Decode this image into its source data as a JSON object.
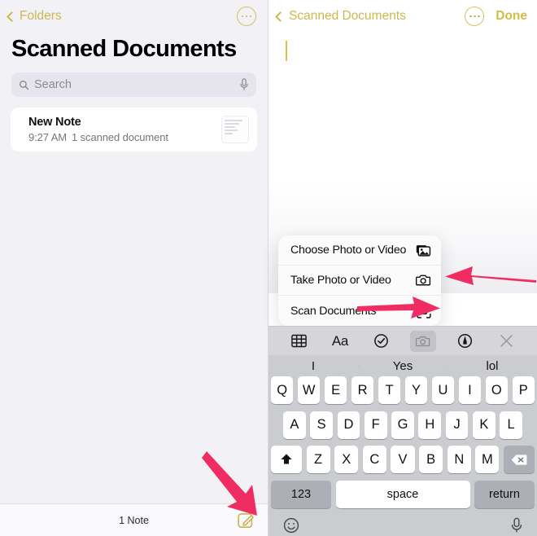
{
  "colors": {
    "accent_yellow": "#cdb84f",
    "arrow_pink": "#ef2d63",
    "panel_bg": "#f2f1f6",
    "keyboard_bg": "#cbccd0",
    "toolbar_bg": "#d6d6da"
  },
  "left_pane": {
    "back_label": "Folders",
    "more_icon": "ellipsis-circle-icon",
    "title": "Scanned Documents",
    "search": {
      "placeholder": "Search",
      "search_icon": "search-icon",
      "mic_icon": "microphone-icon"
    },
    "notes": [
      {
        "title": "New Note",
        "time": "9:27 AM",
        "detail": "1 scanned document",
        "thumb_icon": "scanned-document-thumbnail"
      }
    ],
    "bottom_bar": {
      "count_label": "1 Note",
      "compose_icon": "compose-note-icon"
    }
  },
  "right_pane": {
    "back_label": "Scanned Documents",
    "more_icon": "ellipsis-circle-icon",
    "done_label": "Done",
    "editor": {
      "text": "",
      "caret_visible": true
    },
    "action_sheet": {
      "items": [
        {
          "label": "Choose Photo or Video",
          "icon": "photo-stack-icon"
        },
        {
          "label": "Take Photo or Video",
          "icon": "camera-icon"
        },
        {
          "label": "Scan Documents",
          "icon": "scan-documents-icon"
        }
      ]
    },
    "format_toolbar": {
      "buttons": [
        {
          "name": "table-icon",
          "label": ""
        },
        {
          "name": "text-format-icon",
          "label": "Aa"
        },
        {
          "name": "checklist-icon",
          "label": ""
        },
        {
          "name": "camera-icon",
          "label": "",
          "active": true
        },
        {
          "name": "markup-pen-icon",
          "label": ""
        },
        {
          "name": "close-icon",
          "label": ""
        }
      ]
    },
    "keyboard": {
      "predictions": [
        "I",
        "Yes",
        "lol"
      ],
      "row1": [
        "Q",
        "W",
        "E",
        "R",
        "T",
        "Y",
        "U",
        "I",
        "O",
        "P"
      ],
      "row2": [
        "A",
        "S",
        "D",
        "F",
        "G",
        "H",
        "J",
        "K",
        "L"
      ],
      "row3": [
        "Z",
        "X",
        "C",
        "V",
        "B",
        "N",
        "M"
      ],
      "shift_icon": "shift-icon",
      "delete_icon": "backspace-icon",
      "numbers_label": "123",
      "space_label": "space",
      "return_label": "return",
      "emoji_icon": "emoji-icon",
      "dictation_icon": "microphone-icon"
    }
  },
  "annotations": [
    {
      "name": "arrow-to-scan-documents",
      "direction": "left",
      "target": "Scan Documents"
    },
    {
      "name": "arrow-to-camera-toolbar",
      "direction": "right",
      "target": "camera toolbar button"
    },
    {
      "name": "arrow-to-compose-button",
      "direction": "down-right",
      "target": "compose note button"
    }
  ]
}
